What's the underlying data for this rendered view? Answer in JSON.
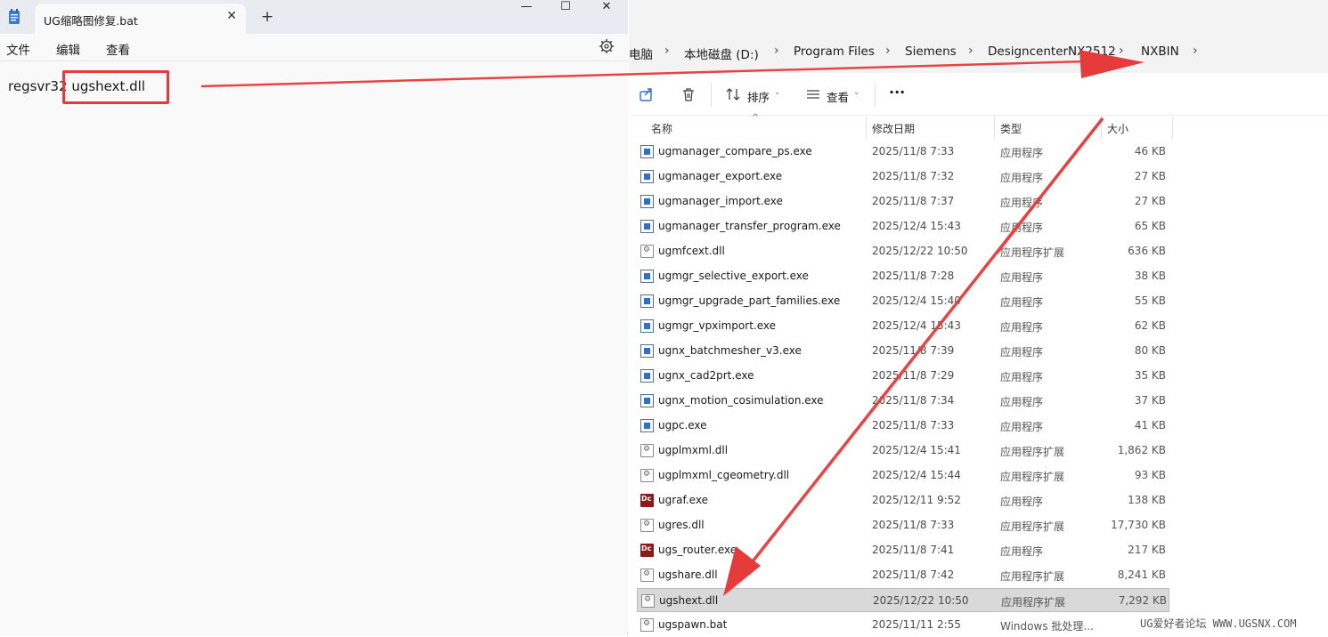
{
  "notepad": {
    "tab_title": "UG缩略图修复.bat",
    "menu": {
      "file": "文件",
      "edit": "编辑",
      "view": "查看"
    },
    "line_prefix": "regsvr32 ",
    "line_highlight": "ugshext.dll",
    "icons": [
      "notepad-icon",
      "close-icon",
      "plus-icon",
      "minimize-icon",
      "maximize-icon",
      "gear-icon"
    ]
  },
  "explorer": {
    "breadcrumbs": [
      "电脑",
      "本地磁盘 (D:)",
      "Program Files",
      "Siemens",
      "DesigncenterNX2512",
      "NXBIN"
    ],
    "toolbar": {
      "sort": "排序",
      "view": "查看",
      "more": "···"
    },
    "columns": {
      "name": "名称",
      "date": "修改日期",
      "type": "类型",
      "size": "大小"
    },
    "rows": [
      {
        "name": "ugmanager_compare_ps.exe",
        "date": "2025/11/8 7:33",
        "type": "应用程序",
        "size": "46 KB",
        "icon": "exe"
      },
      {
        "name": "ugmanager_export.exe",
        "date": "2025/11/8 7:32",
        "type": "应用程序",
        "size": "27 KB",
        "icon": "exe"
      },
      {
        "name": "ugmanager_import.exe",
        "date": "2025/11/8 7:37",
        "type": "应用程序",
        "size": "27 KB",
        "icon": "exe"
      },
      {
        "name": "ugmanager_transfer_program.exe",
        "date": "2025/12/4 15:43",
        "type": "应用程序",
        "size": "65 KB",
        "icon": "exe"
      },
      {
        "name": "ugmfcext.dll",
        "date": "2025/12/22 10:50",
        "type": "应用程序扩展",
        "size": "636 KB",
        "icon": "dll"
      },
      {
        "name": "ugmgr_selective_export.exe",
        "date": "2025/11/8 7:28",
        "type": "应用程序",
        "size": "38 KB",
        "icon": "exe"
      },
      {
        "name": "ugmgr_upgrade_part_families.exe",
        "date": "2025/12/4 15:40",
        "type": "应用程序",
        "size": "55 KB",
        "icon": "exe"
      },
      {
        "name": "ugmgr_vpximport.exe",
        "date": "2025/12/4 15:43",
        "type": "应用程序",
        "size": "62 KB",
        "icon": "exe"
      },
      {
        "name": "ugnx_batchmesher_v3.exe",
        "date": "2025/11/8 7:39",
        "type": "应用程序",
        "size": "80 KB",
        "icon": "exe"
      },
      {
        "name": "ugnx_cad2prt.exe",
        "date": "2025/11/8 7:29",
        "type": "应用程序",
        "size": "35 KB",
        "icon": "exe"
      },
      {
        "name": "ugnx_motion_cosimulation.exe",
        "date": "2025/11/8 7:34",
        "type": "应用程序",
        "size": "37 KB",
        "icon": "exe"
      },
      {
        "name": "ugpc.exe",
        "date": "2025/11/8 7:33",
        "type": "应用程序",
        "size": "41 KB",
        "icon": "exe"
      },
      {
        "name": "ugplmxml.dll",
        "date": "2025/12/4 15:41",
        "type": "应用程序扩展",
        "size": "1,862 KB",
        "icon": "dll"
      },
      {
        "name": "ugplmxml_cgeometry.dll",
        "date": "2025/12/4 15:44",
        "type": "应用程序扩展",
        "size": "93 KB",
        "icon": "dll"
      },
      {
        "name": "ugraf.exe",
        "date": "2025/12/11 9:52",
        "type": "应用程序",
        "size": "138 KB",
        "icon": "dc"
      },
      {
        "name": "ugres.dll",
        "date": "2025/11/8 7:33",
        "type": "应用程序扩展",
        "size": "17,730 KB",
        "icon": "dll"
      },
      {
        "name": "ugs_router.exe",
        "date": "2025/11/8 7:41",
        "type": "应用程序",
        "size": "217 KB",
        "icon": "dc"
      },
      {
        "name": "ugshare.dll",
        "date": "2025/11/8 7:42",
        "type": "应用程序扩展",
        "size": "8,241 KB",
        "icon": "dll"
      },
      {
        "name": "ugshext.dll",
        "date": "2025/12/22 10:50",
        "type": "应用程序扩展",
        "size": "7,292 KB",
        "icon": "dll",
        "selected": true
      },
      {
        "name": "ugspawn.bat",
        "date": "2025/11/11 2:55",
        "type": "Windows 批处理...",
        "size": "",
        "icon": "bat"
      }
    ]
  },
  "watermark": "UG爱好者论坛 WWW.UGSNX.COM",
  "colors": {
    "annotation_red": "#e53b3b",
    "selection": "#d9d9d9",
    "accent_blue": "#2c6fcf"
  }
}
